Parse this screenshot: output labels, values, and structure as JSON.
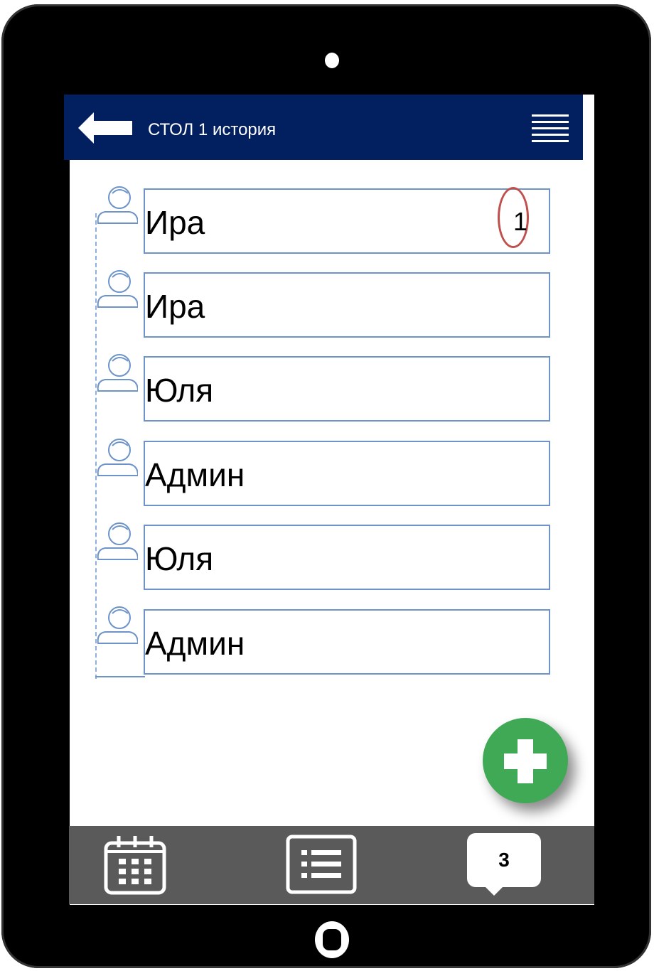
{
  "header": {
    "title": "СТОЛ 1 история",
    "back_icon": "back-arrow-icon",
    "menu_icon": "hamburger-menu-icon"
  },
  "history": [
    {
      "name": "Ира",
      "count": "1"
    },
    {
      "name": "Ира"
    },
    {
      "name": "Юля"
    },
    {
      "name": "Админ"
    },
    {
      "name": "Юля"
    },
    {
      "name": "Админ"
    }
  ],
  "fab": {
    "icon": "plus-icon",
    "color": "#3fa956"
  },
  "bottom_bar": {
    "calendar_icon": "calendar-icon",
    "list_icon": "list-icon",
    "chat_icon": "chat-bubble-icon",
    "chat_count": "3"
  },
  "colors": {
    "header": "#022060",
    "row_border": "#6d93c8",
    "highlight_ring": "#c0504d",
    "bottom_bar": "#5a5a5a"
  }
}
